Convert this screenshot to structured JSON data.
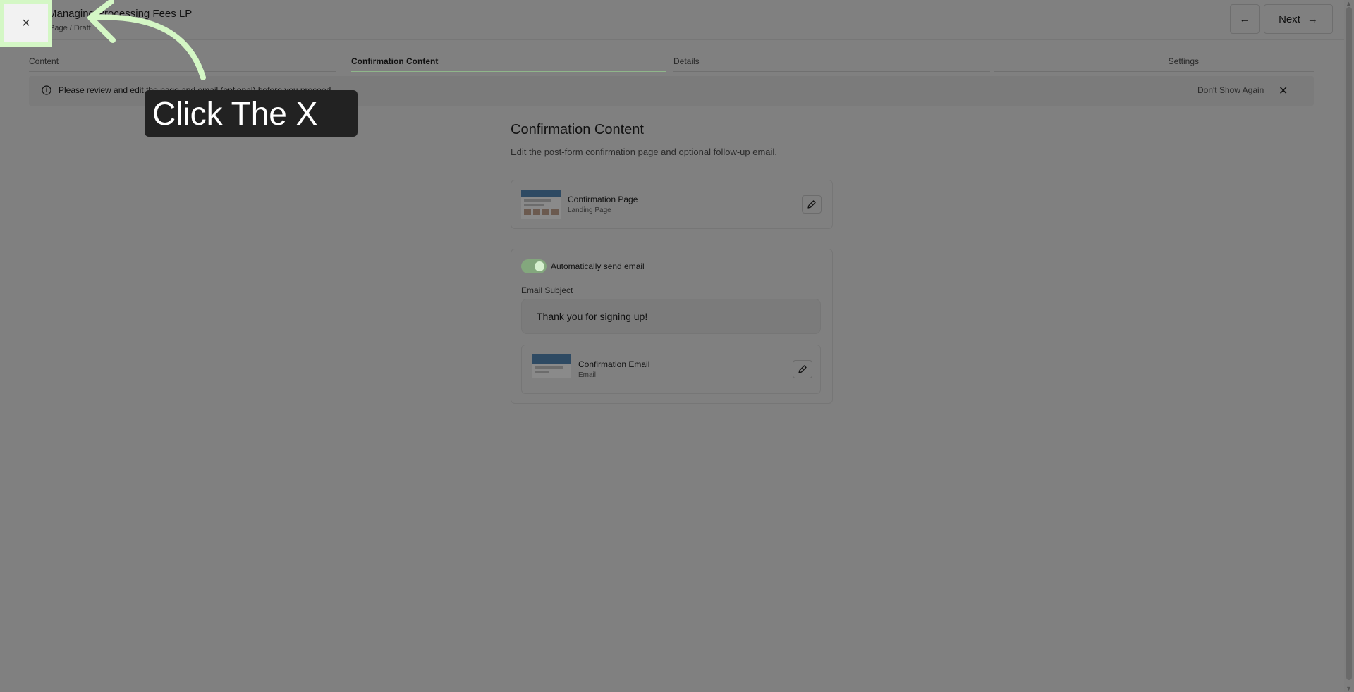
{
  "header": {
    "close_glyph": "×",
    "title": "Managing Processing Fees LP",
    "subtitle": "Page / Draft",
    "back_glyph": "←",
    "next_label": "Next",
    "next_glyph": "→"
  },
  "steps": [
    {
      "label": "Content",
      "active": false
    },
    {
      "label": "Confirmation Content",
      "active": true
    },
    {
      "label": "Details",
      "active": false
    },
    {
      "label": "Settings",
      "active": false
    }
  ],
  "banner": {
    "icon": "info-icon",
    "text": "Please review and edit the page and email (optional) before you proceed.",
    "dont_show_label": "Don't Show Again",
    "close_glyph": "✕"
  },
  "callout": {
    "text": "Click The X",
    "accent_color": "#d4f7c5"
  },
  "main": {
    "title": "Confirmation Content",
    "description": "Edit the post-form confirmation page and optional follow-up email.",
    "confirmation_page": {
      "title": "Confirmation Page",
      "subtitle": "Landing Page",
      "edit_icon": "pencil-icon"
    },
    "email_section": {
      "toggle_label": "Automatically send email",
      "toggle_on": true,
      "subject_label": "Email Subject",
      "subject_value": "Thank you for signing up!",
      "confirmation_email": {
        "title": "Confirmation Email",
        "subtitle": "Email",
        "edit_icon": "pencil-icon"
      }
    }
  }
}
